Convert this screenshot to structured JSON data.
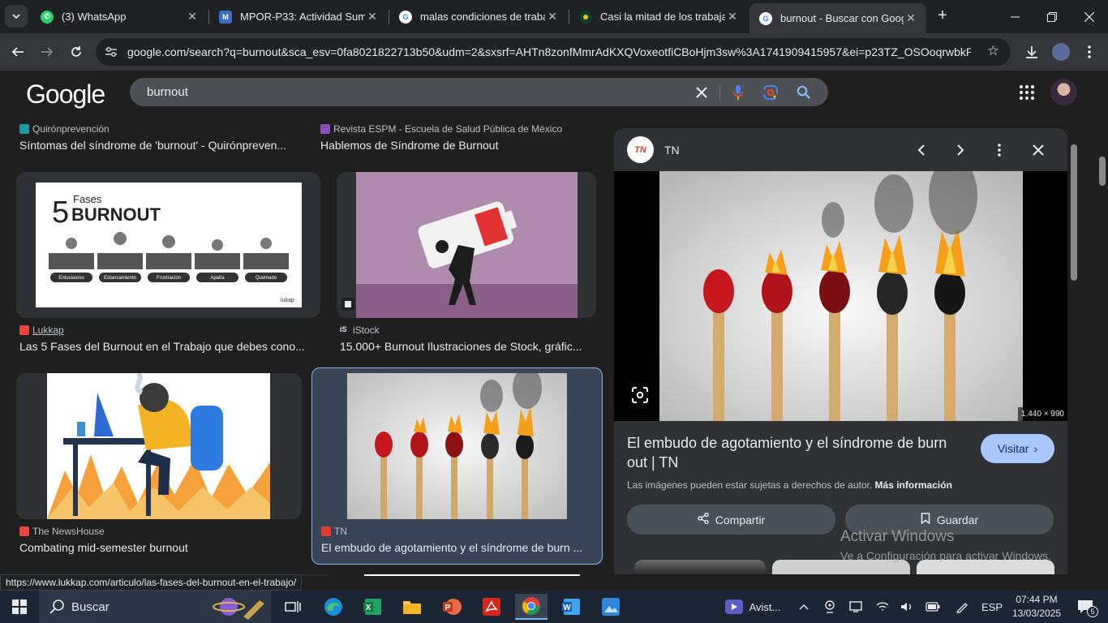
{
  "browser": {
    "tabs": [
      {
        "title": "(3) WhatsApp",
        "favicon": "whatsapp-icon",
        "color": "#25d366"
      },
      {
        "title": "MPOR-P33: Actividad Sumat",
        "favicon": "moodle-icon",
        "color": "#3c6dc6"
      },
      {
        "title": "malas condiciones de trabaj",
        "favicon": "google-icon",
        "color": "#ffffff"
      },
      {
        "title": "Casi la mitad de los trabajad",
        "favicon": "news-icon",
        "color": "#f5c518"
      },
      {
        "title": "burnout - Buscar con Googl",
        "favicon": "google-icon",
        "color": "#ffffff"
      }
    ],
    "url": "google.com/search?q=burnout&sca_esv=0fa8021822713b50&udm=2&sxsrf=AHTn8zonfMmrAdKXQVoxeotfiCBoHjm3sw%3A1741909415957&ei=p23TZ_OSOoqrwbkP..."
  },
  "google": {
    "logo": "Google",
    "query": "burnout"
  },
  "results": [
    {
      "source": "Quirónprevención",
      "title": "Síntomas del síndrome de 'burnout' - Quirónpreven...",
      "favcolor": "#1e9aa6"
    },
    {
      "source": "Revista ESPM - Escuela de Salud Pública de México",
      "title": "Hablemos de Síndrome de Burnout",
      "favcolor": "#8a4fb5"
    },
    {
      "source": "Lukkap",
      "title": "Las 5 Fases del Burnout en el Trabajo que debes cono...",
      "favcolor": "#e8453c"
    },
    {
      "source": "iStock",
      "title": "15.000+ Burnout Ilustraciones de Stock, gráfic...",
      "favcolor": "#e8eaed"
    },
    {
      "source": "The NewsHouse",
      "title": "Combating mid-semester burnout",
      "favcolor": "#e8453c"
    },
    {
      "source": "TN",
      "title": "El embudo de agotamiento y el síndrome de burn ...",
      "favcolor": "#e23b2e"
    }
  ],
  "lukkap_image": {
    "heading_small": "Fases",
    "heading_num": "5",
    "heading_big": "BURNOUT",
    "stages": [
      "Entusiasmo",
      "Estancamiento",
      "Frustración",
      "Apatía",
      "Quemado"
    ],
    "brand": "lukap"
  },
  "preview": {
    "source": "TN",
    "logo_text": "TN",
    "dimensions": "1.440 × 990",
    "title": "El embudo de agotamiento y el síndrome de burn out | TN",
    "visit_label": "Visitar",
    "rights_text": "Las imágenes pueden estar sujetas a derechos de autor.",
    "rights_link": "Más información",
    "share_label": "Compartir",
    "save_label": "Guardar"
  },
  "watermark": {
    "line1": "Activar Windows",
    "line2": "Ve a Configuración para activar Windows."
  },
  "status_url": "https://www.lukkap.com/articulo/las-fases-del-burnout-en-el-trabajo/",
  "taskbar": {
    "search_placeholder": "Buscar",
    "running_app": "Avist...",
    "language": "ESP",
    "time": "07:44 PM",
    "date": "13/03/2025",
    "notification_count": "5"
  }
}
